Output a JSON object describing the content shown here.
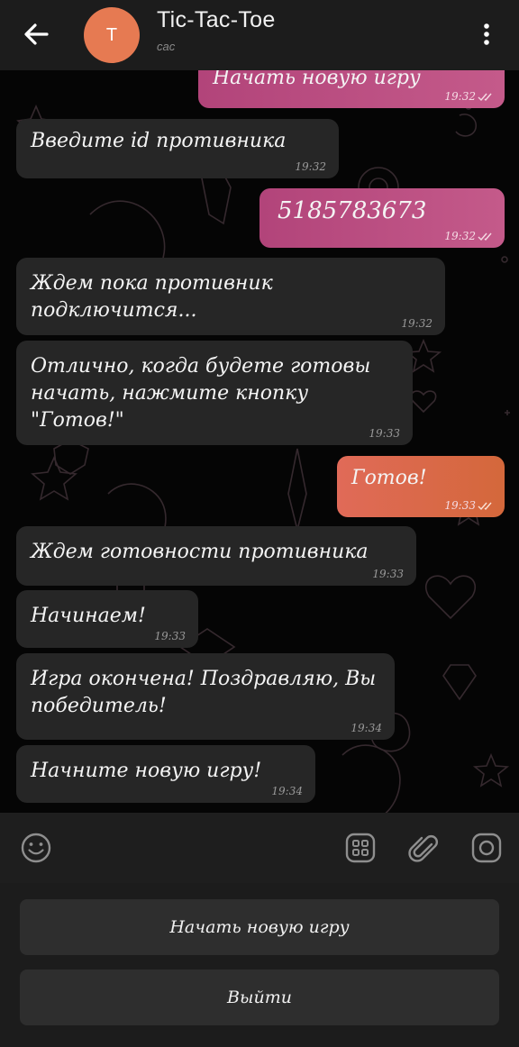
{
  "header": {
    "back_icon": "arrow-left-icon",
    "avatar_letter": "T",
    "avatar_color": "#e67a52",
    "title": "Tic-Tac-Toe",
    "subtitle": "сас",
    "menu_icon": "more-vertical-icon"
  },
  "messages": [
    {
      "direction": "out",
      "text": "Начать новую игру",
      "time": "19:32",
      "status": "read"
    },
    {
      "direction": "in",
      "text": "Введите id противника",
      "time": "19:32"
    },
    {
      "direction": "out",
      "text": "5185783673",
      "time": "19:32",
      "status": "read"
    },
    {
      "direction": "in",
      "text": "Ждем пока противник подключится...",
      "time": "19:32"
    },
    {
      "direction": "in",
      "text_lines": [
        "Отлично, когда будете готовы",
        "начать, нажмите кнопку \"Готов!\""
      ],
      "time": "19:33"
    },
    {
      "direction": "out",
      "text": "Готов!",
      "time": "19:33",
      "status": "read"
    },
    {
      "direction": "in",
      "text": "Ждем готовности противника",
      "time": "19:33"
    },
    {
      "direction": "in",
      "text": "Начинаем!",
      "time": "19:33"
    },
    {
      "direction": "in",
      "text_lines": [
        "Игра окончена! Поздравляю, Вы",
        "победитель!"
      ],
      "time": "19:34"
    },
    {
      "direction": "in",
      "text": "Начните новую игру!",
      "time": "19:34"
    }
  ],
  "input_bar": {
    "emoji_icon": "emoji-icon",
    "placeholder": "",
    "bot_keyboard_icon": "keyboard-grid-icon",
    "attach_icon": "paperclip-icon",
    "camera_icon": "camera-icon"
  },
  "keyboard": {
    "buttons": [
      "Начать новую игру",
      "Выйти"
    ]
  },
  "colors": {
    "incoming_bubble": "#262626",
    "outgoing_pink": "#c0508a",
    "outgoing_orange": "#d8683e",
    "header_bg": "#1c1c1c"
  }
}
